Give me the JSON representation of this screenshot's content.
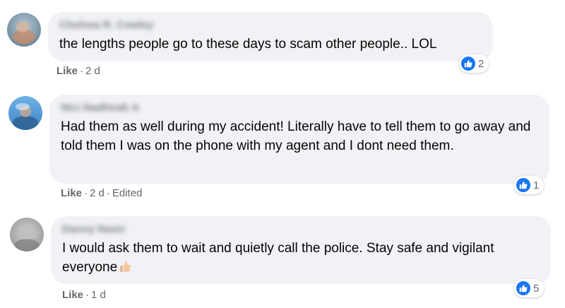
{
  "comments": [
    {
      "author": "Chelsea R. Cowley",
      "text": "the lengths people go to these days to scam other people.. LOL",
      "like_label": "Like",
      "time": "2 d",
      "edited": "",
      "reaction_count": "2"
    },
    {
      "author": "Nici Nadhirah A",
      "text": "Had them as well during my accident! Literally have to tell them to go away and told them I was on the phone with my agent and I dont need them.",
      "like_label": "Like",
      "time": "2 d",
      "edited": "Edited",
      "reaction_count": "1"
    },
    {
      "author": "Danny Nasic",
      "text": "I would ask them to wait and quietly call the police. Stay safe and vigilant everyone",
      "like_label": "Like",
      "time": "1 d",
      "edited": "",
      "reaction_count": "5"
    }
  ],
  "icons": {
    "reaction": "like-thumbs-up-icon",
    "emoji": "thumbs-up-emoji"
  },
  "colors": {
    "bubble": "#f0f2f5",
    "like_blue": "#1877f2",
    "meta_gray": "#65676b"
  }
}
